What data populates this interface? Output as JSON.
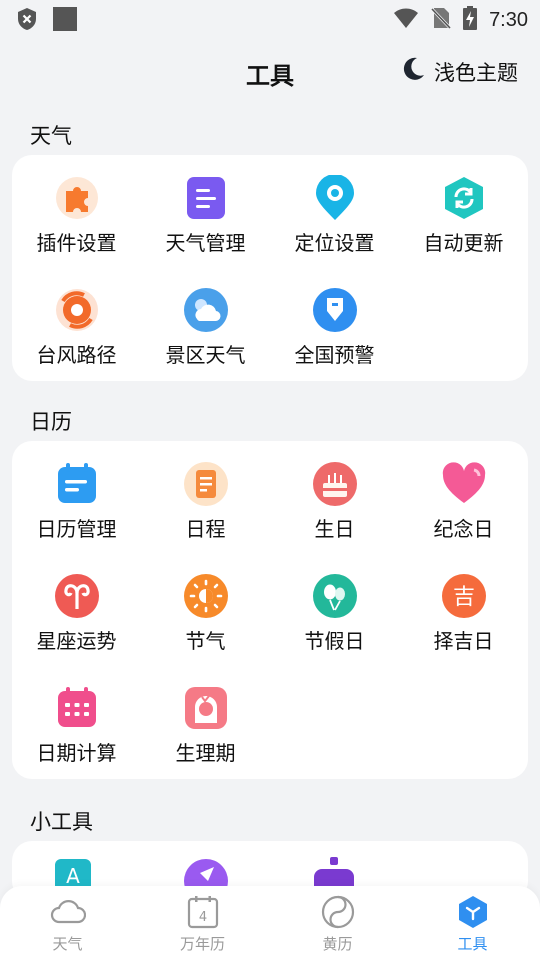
{
  "status_bar": {
    "time": "7:30"
  },
  "header": {
    "title": "工具",
    "theme_label": "浅色主题"
  },
  "sections": {
    "weather": {
      "title": "天气",
      "items": [
        {
          "label": "插件设置",
          "icon": "puzzle-icon"
        },
        {
          "label": "天气管理",
          "icon": "list-icon"
        },
        {
          "label": "定位设置",
          "icon": "location-pin-icon"
        },
        {
          "label": "自动更新",
          "icon": "refresh-icon"
        },
        {
          "label": "台风路径",
          "icon": "typhoon-icon"
        },
        {
          "label": "景区天气",
          "icon": "cloud-sun-icon"
        },
        {
          "label": "全国预警",
          "icon": "warning-shield-icon"
        }
      ]
    },
    "calendar": {
      "title": "日历",
      "items": [
        {
          "label": "日历管理",
          "icon": "calendar-icon"
        },
        {
          "label": "日程",
          "icon": "notepad-icon"
        },
        {
          "label": "生日",
          "icon": "cake-icon"
        },
        {
          "label": "纪念日",
          "icon": "heart-icon"
        },
        {
          "label": "星座运势",
          "icon": "aries-icon"
        },
        {
          "label": "节气",
          "icon": "sun-icon"
        },
        {
          "label": "节假日",
          "icon": "balloon-icon"
        },
        {
          "label": "择吉日",
          "icon": "ji-icon"
        },
        {
          "label": "日期计算",
          "icon": "calendar-grid-icon"
        },
        {
          "label": "生理期",
          "icon": "female-icon"
        }
      ],
      "ji_glyph": "吉"
    },
    "tools": {
      "title": "小工具"
    }
  },
  "bottom_nav": [
    {
      "label": "天气",
      "icon": "cloud-icon"
    },
    {
      "label": "万年历",
      "icon": "calendar-day-icon",
      "day": "4"
    },
    {
      "label": "黄历",
      "icon": "yin-yang-icon"
    },
    {
      "label": "工具",
      "icon": "tools-cube-icon",
      "active": true
    }
  ],
  "colors": {
    "accent": "#2f8ff0",
    "background": "#f2f3f5"
  }
}
